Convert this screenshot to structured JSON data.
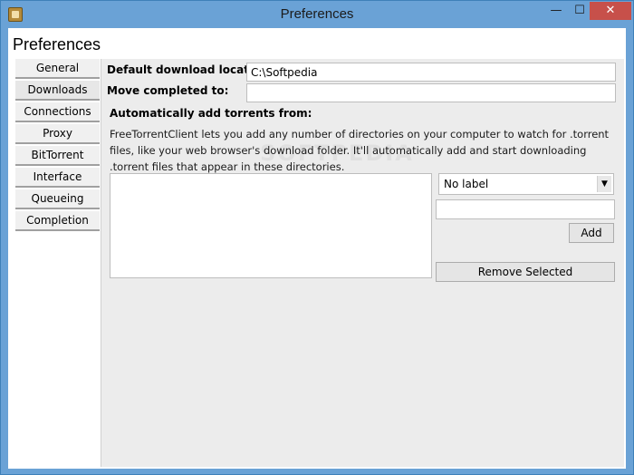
{
  "window": {
    "title": "Preferences",
    "controls": {
      "minimize": "—",
      "maximize": "☐",
      "close": "✕"
    }
  },
  "page": {
    "heading": "Preferences"
  },
  "tabs": [
    {
      "label": "General"
    },
    {
      "label": "Downloads",
      "active": true
    },
    {
      "label": "Connections"
    },
    {
      "label": "Proxy"
    },
    {
      "label": "BitTorrent"
    },
    {
      "label": "Interface"
    },
    {
      "label": "Queueing"
    },
    {
      "label": "Completion"
    }
  ],
  "downloads": {
    "default_location_label": "Default download location:",
    "default_location_value": "C:\\Softpedia",
    "move_completed_label": "Move completed to:",
    "move_completed_value": "",
    "auto_add_label": "Automatically add torrents from:",
    "description": "FreeTorrentClient lets you add any number of directories on your computer to watch for .torrent files, like your web browser's download folder. It'll automatically add and start downloading .torrent files that appear in these directories.",
    "label_select_value": "No label",
    "new_dir_value": "",
    "add_button": "Add",
    "remove_button": "Remove Selected"
  },
  "watermark": "SOFTPEDIA"
}
